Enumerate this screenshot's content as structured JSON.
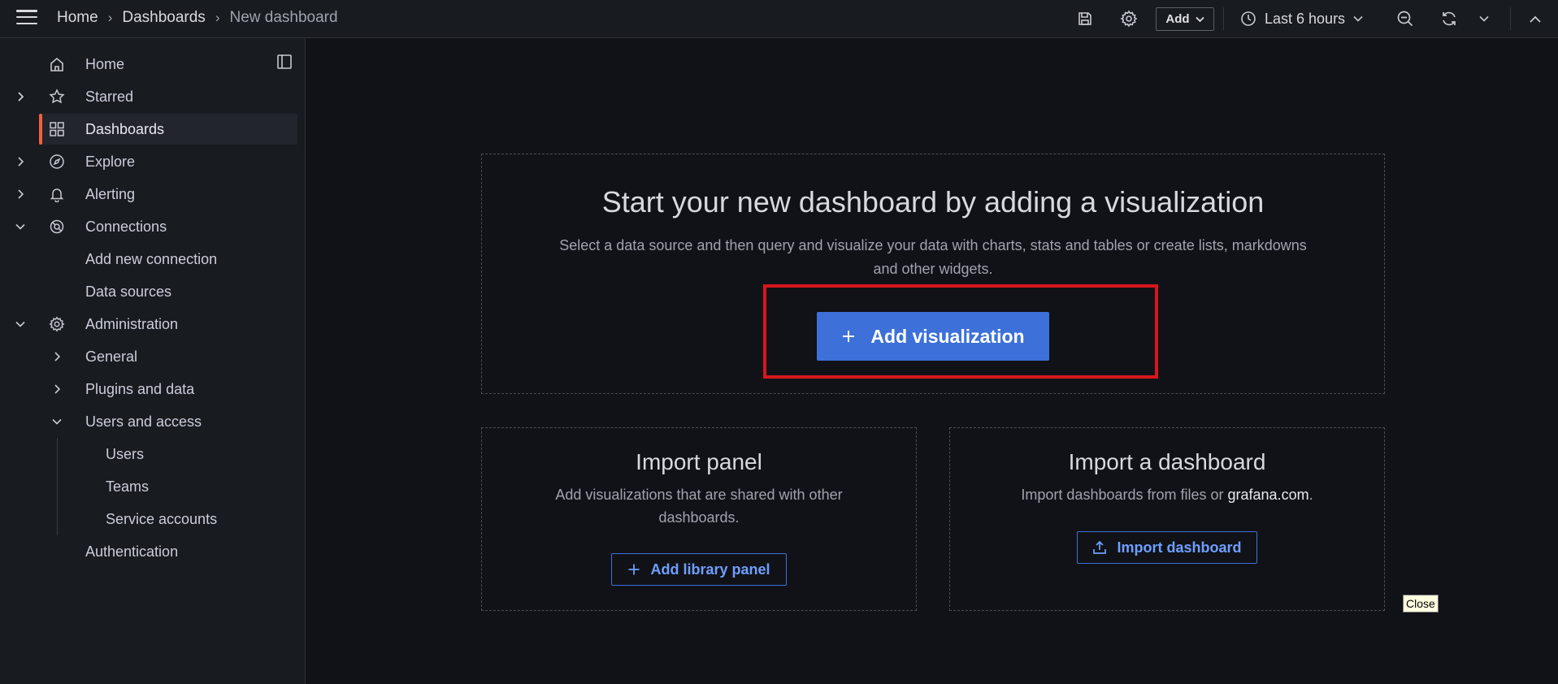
{
  "topbar": {
    "breadcrumbs": [
      "Home",
      "Dashboards",
      "New dashboard"
    ],
    "add_label": "Add",
    "time_range": "Last 6 hours"
  },
  "sidebar": {
    "items": [
      {
        "label": "Home",
        "icon": "home-icon"
      },
      {
        "label": "Starred",
        "icon": "star-icon",
        "expanded": false
      },
      {
        "label": "Dashboards",
        "icon": "apps-icon",
        "expanded": false,
        "active": true
      },
      {
        "label": "Explore",
        "icon": "compass-icon",
        "expanded": false
      },
      {
        "label": "Alerting",
        "icon": "bell-icon",
        "expanded": false
      },
      {
        "label": "Connections",
        "icon": "connections-icon",
        "expanded": true
      },
      {
        "label": "Add new connection"
      },
      {
        "label": "Data sources"
      },
      {
        "label": "Administration",
        "icon": "cog-icon",
        "expanded": true
      },
      {
        "label": "General",
        "expanded": false
      },
      {
        "label": "Plugins and data",
        "expanded": false
      },
      {
        "label": "Users and access",
        "expanded": true
      },
      {
        "label": "Users"
      },
      {
        "label": "Teams"
      },
      {
        "label": "Service accounts"
      },
      {
        "label": "Authentication"
      }
    ]
  },
  "main": {
    "hero": {
      "title": "Start your new dashboard by adding a visualization",
      "subtitle": "Select a data source and then query and visualize your data with charts, stats and tables or create lists, markdowns and other widgets.",
      "button": "Add visualization"
    },
    "import_panel": {
      "title": "Import panel",
      "subtitle": "Add visualizations that are shared with other dashboards.",
      "button": "Add library panel"
    },
    "import_dashboard": {
      "title": "Import a dashboard",
      "subtitle_prefix": "Import dashboards from files or ",
      "link": "grafana.com",
      "subtitle_suffix": ".",
      "button": "Import dashboard"
    }
  },
  "tooltip": "Close",
  "colors": {
    "primary": "#3d71d9",
    "active_indicator": "#f55f3e",
    "highlight": "#d6171c"
  }
}
